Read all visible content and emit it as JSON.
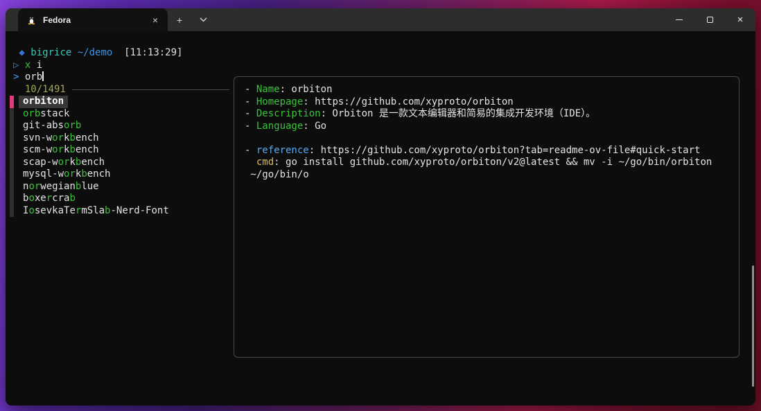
{
  "titlebar": {
    "tab": {
      "label": "Fedora",
      "icon": "tux-penguin-icon",
      "close_glyph": "×"
    },
    "new_tab_glyph": "+",
    "dropdown_icon": "chevron-down-icon",
    "controls": {
      "minimize": "minimize",
      "maximize": "maximize",
      "close_glyph": "×"
    }
  },
  "terminal": {
    "prompt": {
      "symbol": " ◆ ",
      "user": "bigrice ",
      "dir": "~/demo",
      "time": "  [11:13:29]"
    },
    "history_line": {
      "symbol": "▷ ",
      "cmd": "x ",
      "arg": "i"
    }
  },
  "fzf": {
    "query_prompt": "> ",
    "query": "orb",
    "counter": "  10/1491",
    "selected_index": 0,
    "items": [
      {
        "name": "orbiton",
        "selected": true
      },
      {
        "name": "orbstack",
        "s1": "",
        "s2": "orb",
        "s3": "stack",
        "s4": "",
        "s5": "",
        "s6": "",
        "s7": ""
      },
      {
        "name": "git-absorb",
        "s1": "git-abs",
        "s2": "orb",
        "s3": "",
        "s4": "",
        "s5": "",
        "s6": "",
        "s7": ""
      },
      {
        "name": "svn-workbench",
        "s1": "svn-w",
        "s2": "or",
        "s3": "k",
        "s4": "b",
        "s5": "ench",
        "s6": "",
        "s7": ""
      },
      {
        "name": "scm-workbench",
        "s1": "scm-w",
        "s2": "or",
        "s3": "k",
        "s4": "b",
        "s5": "ench",
        "s6": "",
        "s7": ""
      },
      {
        "name": "scap-workbench",
        "s1": "scap-w",
        "s2": "or",
        "s3": "k",
        "s4": "b",
        "s5": "ench",
        "s6": "",
        "s7": ""
      },
      {
        "name": "mysql-workbench",
        "s1": "mysql-w",
        "s2": "or",
        "s3": "k",
        "s4": "b",
        "s5": "ench",
        "s6": "",
        "s7": ""
      },
      {
        "name": "norwegianblue",
        "s1": "n",
        "s2": "or",
        "s3": "wegian",
        "s4": "b",
        "s5": "lue",
        "s6": "",
        "s7": ""
      },
      {
        "name": "boxercrab",
        "s1": "b",
        "s2": "o",
        "s3": "xe",
        "s4": "r",
        "s5": "cra",
        "s6": "b",
        "s7": ""
      },
      {
        "name": "IosevkaTermSlab-Nerd-Font",
        "s1": "I",
        "s2": "o",
        "s3": "sevkaTe",
        "s4": "r",
        "s5": "mSla",
        "s6": "b",
        "s7": "-Nerd-Font"
      }
    ]
  },
  "preview": {
    "lines": [
      {
        "bullet": "- ",
        "label": "Name",
        "rest": ": orbiton"
      },
      {
        "bullet": "- ",
        "label": "Homepage",
        "rest": ": https://github.com/xyproto/orbiton"
      },
      {
        "bullet": "- ",
        "label": "Description",
        "rest": ": Orbiton 是一款文本编辑器和简易的集成开发环境（IDE）。"
      },
      {
        "bullet": "- ",
        "label": "Language",
        "rest": ": Go"
      },
      {
        "bullet": "",
        "label": "",
        "rest": ""
      },
      {
        "bullet": "- ",
        "label": "reference",
        "rest": ": https://github.com/xyproto/orbiton?tab=readme-ov-file#quick-start"
      },
      {
        "bullet": "  ",
        "label": "cmd",
        "rest": ": go install github.com/xyproto/orbiton/v2@latest && mv -i ~/go/bin/orbiton"
      },
      {
        "bullet": " ~/go/bin/o",
        "label": "",
        "rest": ""
      }
    ]
  },
  "colors": {
    "terminal_bg": "#0d0d0d",
    "titlebar_bg": "#2d2d2d",
    "green": "#3dc23d",
    "blue": "#4a9df0",
    "teal": "#3fc5b7",
    "cyan": "#58aaf2",
    "yellow": "#d9b964",
    "olive": "#a6a659",
    "pointer_magenta": "#e5397e",
    "selected_bg": "#383838",
    "border_gray": "#4a4a4a"
  }
}
